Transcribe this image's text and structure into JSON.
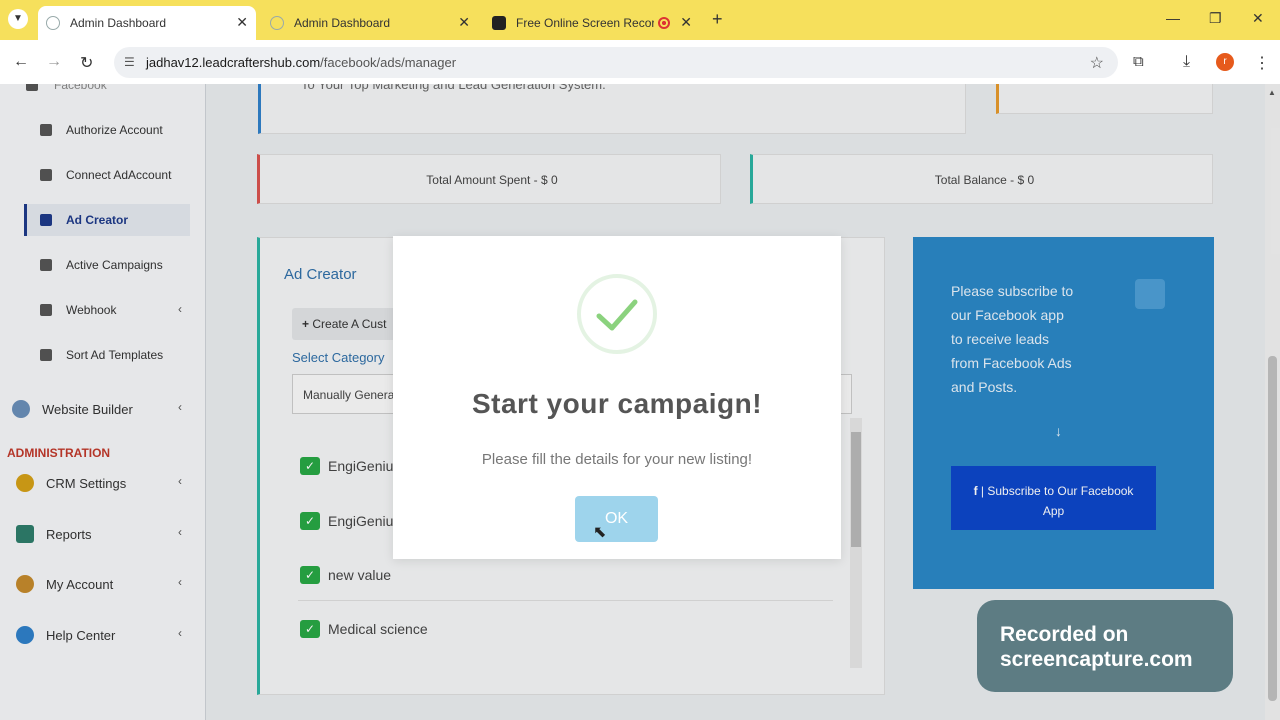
{
  "browser": {
    "tabs": [
      {
        "title": "Admin Dashboard",
        "active": true
      },
      {
        "title": "Admin Dashboard",
        "active": false
      },
      {
        "title": "Free Online Screen Recorde",
        "active": false
      }
    ],
    "new_tab": "+",
    "window_controls": {
      "minimize": "—",
      "restore": "❐",
      "close": "✕"
    },
    "url_domain": "jadhav12.leadcraftershub.com",
    "url_path": "/facebook/ads/manager",
    "profile_initial": "r"
  },
  "sidebar": {
    "partial_top": "Facebook",
    "items": [
      {
        "label": "Authorize Account",
        "icon": "card-icon"
      },
      {
        "label": "Connect AdAccount",
        "icon": "plug-icon"
      },
      {
        "label": "Ad Creator",
        "icon": "plus-square-icon",
        "active": true
      },
      {
        "label": "Active Campaigns",
        "icon": "star-icon"
      },
      {
        "label": "Webhook",
        "icon": "database-icon"
      },
      {
        "label": "Sort Ad Templates",
        "icon": "sort-icon"
      }
    ],
    "website_builder": "Website Builder",
    "section_admin": "ADMINISTRATION",
    "admin_items": [
      {
        "label": "CRM Settings"
      },
      {
        "label": "Reports"
      },
      {
        "label": "My Account"
      },
      {
        "label": "Help Center"
      }
    ]
  },
  "main": {
    "partial_banner": "To Your Top Marketing and Lead Generation System.",
    "total_spent": "Total Amount Spent - $ 0",
    "total_balance": "Total Balance - $ 0",
    "ad_creator_title": "Ad Creator",
    "create_button": "Create A Cust",
    "select_category_label": "Select Category",
    "select_value": "Manually Genera",
    "checklist": [
      {
        "label": "EngiGenius",
        "checked": true
      },
      {
        "label": "EngiGenius",
        "checked": true
      },
      {
        "label": "new value",
        "checked": true
      },
      {
        "label": "Medical science",
        "checked": true
      }
    ]
  },
  "promo": {
    "text": "Please subscribe to our Facebook app to receive leads from Facebook Ads and Posts.",
    "button_line1": "| Subscribe to Our Facebook",
    "button_line2": "App",
    "color": "#2b87c6"
  },
  "modal": {
    "title": "Start your campaign!",
    "message": "Please fill the details for your new listing!",
    "ok": "OK",
    "accent": "#9ed4ec"
  },
  "watermark": {
    "line1": "Recorded on",
    "line2": "screencapture.com"
  }
}
